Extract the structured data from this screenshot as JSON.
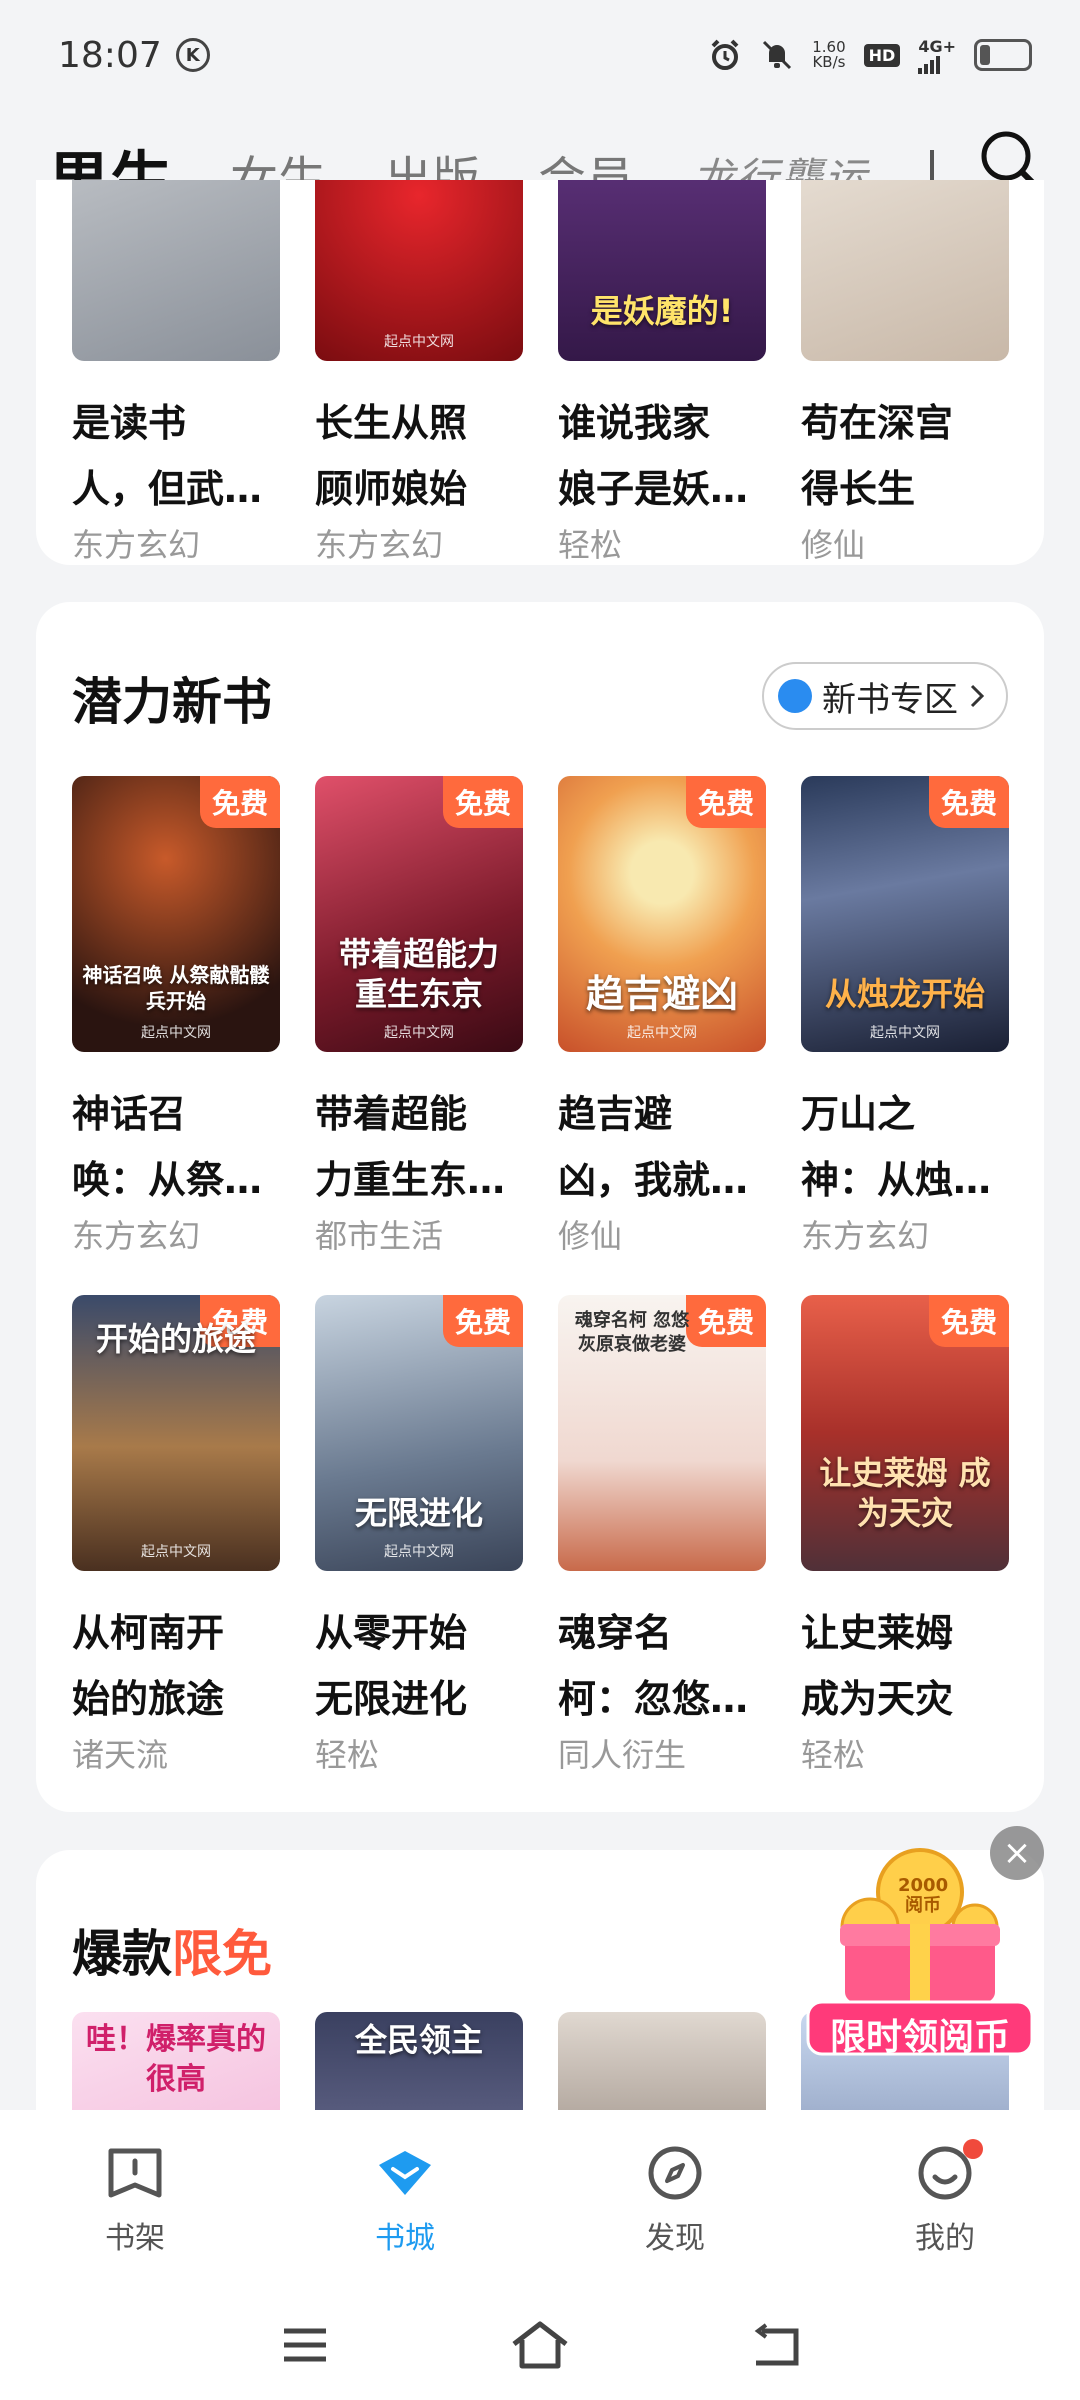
{
  "status_bar": {
    "time": "18:07",
    "k_label": "K",
    "net_speed_value": "1.60",
    "net_speed_unit": "KB/s",
    "hd": "HD",
    "network": "4G+"
  },
  "tabs": [
    "男生",
    "女生",
    "出版",
    "会员",
    "龙行龘运"
  ],
  "colors": {
    "accent": "#1e9bf0",
    "free_badge": "#ff6a3d",
    "highlight_red": "#ff5a3c"
  },
  "section1": {
    "books": [
      {
        "title_l1": "是读书",
        "title_l2": "人，但武…",
        "genre": "东方玄幻"
      },
      {
        "title_l1": "长生从照",
        "title_l2": "顾师娘始",
        "genre": "东方玄幻",
        "cover_pub": "起点中文网"
      },
      {
        "title_l1": "谁说我家",
        "title_l2": "娘子是妖…",
        "genre": "轻松",
        "cover_text": "是妖魔的!"
      },
      {
        "title_l1": "苟在深宫",
        "title_l2": "得长生",
        "genre": "修仙"
      }
    ]
  },
  "section2": {
    "title": "潜力新书",
    "zone_button": "新书专区",
    "free_label": "免费",
    "books": [
      {
        "title_l1": "神话召",
        "title_l2": "唤：从祭…",
        "genre": "东方玄幻",
        "cover_text": "神话召唤 从祭献骷髅兵开始",
        "cover_pub": "起点中文网"
      },
      {
        "title_l1": "带着超能",
        "title_l2": "力重生东…",
        "genre": "都市生活",
        "cover_text": "带着超能力 重生东京",
        "cover_pub": "起点中文网"
      },
      {
        "title_l1": "趋吉避",
        "title_l2": "凶，我就…",
        "genre": "修仙",
        "cover_text": "趋吉避凶",
        "cover_pub": "起点中文网"
      },
      {
        "title_l1": "万山之",
        "title_l2": "神：从烛…",
        "genre": "东方玄幻",
        "cover_text": "从烛龙开始",
        "cover_pub": "起点中文网"
      },
      {
        "title_l1": "从柯南开",
        "title_l2": "始的旅途",
        "genre": "诸天流",
        "cover_text": "开始的旅途",
        "cover_pub": "起点中文网"
      },
      {
        "title_l1": "从零开始",
        "title_l2": "无限进化",
        "genre": "轻松",
        "cover_text": "无限进化",
        "cover_pub": "起点中文网"
      },
      {
        "title_l1": "魂穿名",
        "title_l2": "柯：忽悠…",
        "genre": "同人衍生",
        "cover_text": "魂穿名柯 忽悠灰原哀做老婆"
      },
      {
        "title_l1": "让史莱姆",
        "title_l2": "成为天灾",
        "genre": "轻松",
        "cover_text": "让史莱姆 成为天灾"
      }
    ]
  },
  "section3": {
    "title_prefix": "爆款",
    "title_highlight": "限免",
    "covers": [
      "哇！爆率真的很高",
      "全民领主",
      "",
      ""
    ]
  },
  "promo": {
    "label": "限时领阅币",
    "coin_text": "2000阅币"
  },
  "bottom_nav": [
    "书架",
    "书城",
    "发现",
    "我的"
  ]
}
